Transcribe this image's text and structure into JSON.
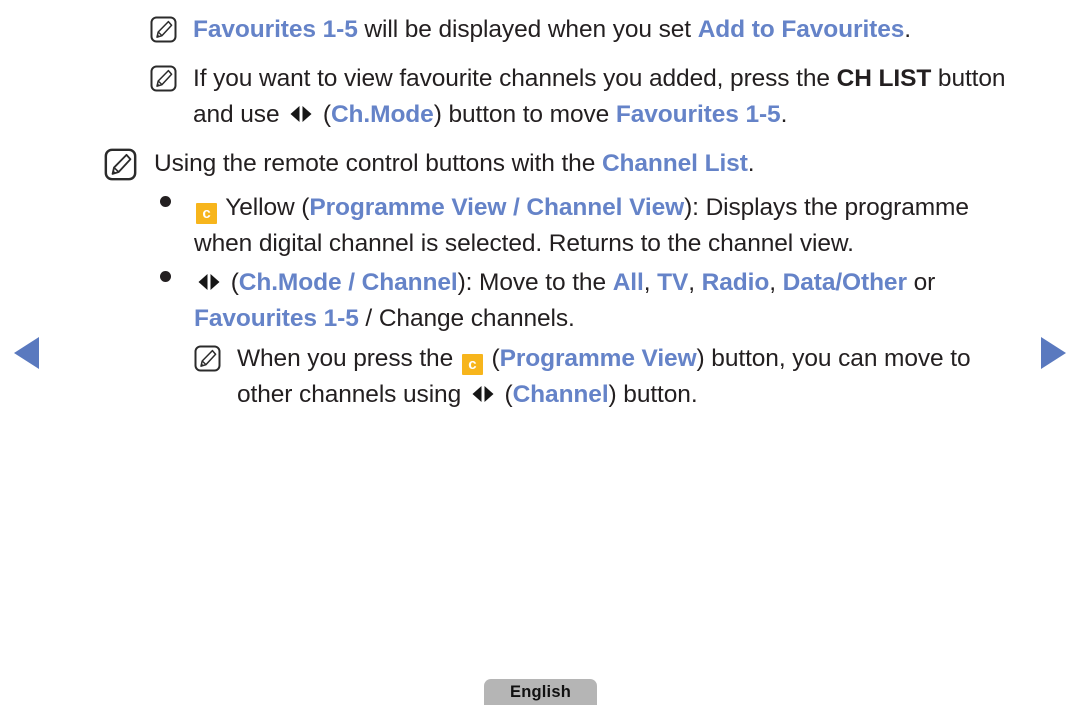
{
  "language_button": {
    "label": "English",
    "bg_color": "#b5b5b5"
  },
  "nav": {
    "prev_label": "Previous page",
    "next_label": "Next page",
    "arrow_color": "#5a79bf"
  },
  "theme": {
    "text_color": "#231f20",
    "accent_blue": "#6583c8",
    "badge_yellow": "#f7b51c",
    "background": "#ffffff"
  },
  "icons": {
    "note": "note-pencil-icon",
    "left_right_arrows": "left-right-arrows-icon",
    "bullet": "bullet-dot-icon",
    "c_badge": "yellow-c-button-icon"
  },
  "content": {
    "note1": {
      "segments": [
        {
          "text": "Favourites 1-5",
          "style": "blue"
        },
        {
          "text": " will be displayed when you set ",
          "style": "plain"
        },
        {
          "text": "Add to Favourites",
          "style": "blue"
        },
        {
          "text": ".",
          "style": "plain"
        }
      ]
    },
    "note2": {
      "segments": [
        {
          "text": "If you want to view favourite channels you added, press the ",
          "style": "plain"
        },
        {
          "text": "CH LIST",
          "style": "bold"
        },
        {
          "text": " button and use ",
          "style": "plain"
        },
        {
          "text": "",
          "style": "lr-arrows"
        },
        {
          "text": " (",
          "style": "plain"
        },
        {
          "text": "Ch.Mode",
          "style": "blue"
        },
        {
          "text": ") button to move ",
          "style": "plain"
        },
        {
          "text": "Favourites 1-5",
          "style": "blue"
        },
        {
          "text": ".",
          "style": "plain"
        }
      ]
    },
    "note3": {
      "segments": [
        {
          "text": "Using the remote control buttons with the ",
          "style": "plain"
        },
        {
          "text": "Channel List",
          "style": "blue"
        },
        {
          "text": ".",
          "style": "plain"
        }
      ]
    },
    "bullet1": {
      "segments": [
        {
          "text": "c",
          "style": "c-badge"
        },
        {
          "text": " Yellow (",
          "style": "plain"
        },
        {
          "text": "Programme View / Channel View",
          "style": "blue"
        },
        {
          "text": "): Displays the programme when digital channel is selected. Returns to the channel view.",
          "style": "plain"
        }
      ]
    },
    "bullet2": {
      "segments": [
        {
          "text": "",
          "style": "lr-arrows"
        },
        {
          "text": " (",
          "style": "plain"
        },
        {
          "text": "Ch.Mode / Channel",
          "style": "blue"
        },
        {
          "text": "): Move to the ",
          "style": "plain"
        },
        {
          "text": "All",
          "style": "blue"
        },
        {
          "text": ", ",
          "style": "plain"
        },
        {
          "text": "TV",
          "style": "blue"
        },
        {
          "text": ", ",
          "style": "plain"
        },
        {
          "text": "Radio",
          "style": "blue"
        },
        {
          "text": ", ",
          "style": "plain"
        },
        {
          "text": "Data/Other",
          "style": "blue"
        },
        {
          "text": " or ",
          "style": "plain"
        },
        {
          "text": "Favourites 1-5",
          "style": "blue"
        },
        {
          "text": " / Change channels.",
          "style": "plain"
        }
      ]
    },
    "note4": {
      "segments": [
        {
          "text": "When you press the ",
          "style": "plain"
        },
        {
          "text": "c",
          "style": "c-badge"
        },
        {
          "text": " (",
          "style": "plain"
        },
        {
          "text": "Programme View",
          "style": "blue"
        },
        {
          "text": ") button, you can move to other channels using ",
          "style": "plain"
        },
        {
          "text": "",
          "style": "lr-arrows"
        },
        {
          "text": " (",
          "style": "plain"
        },
        {
          "text": "Channel",
          "style": "blue"
        },
        {
          "text": ") button.",
          "style": "plain"
        }
      ]
    }
  }
}
